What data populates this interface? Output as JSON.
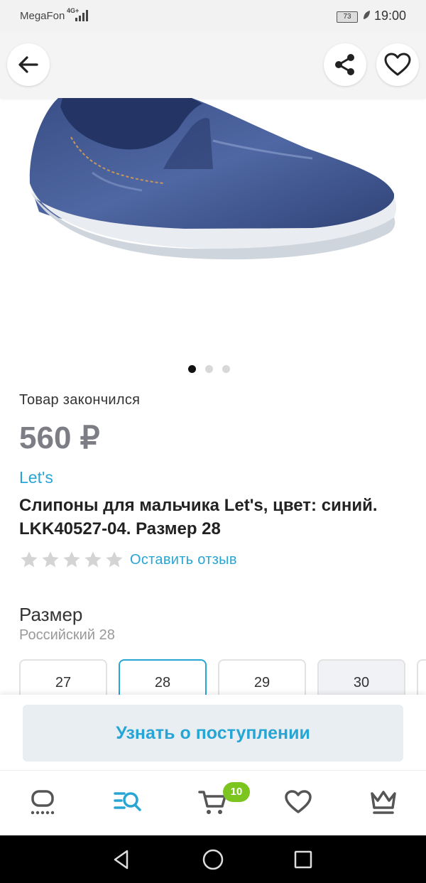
{
  "status_bar": {
    "carrier": "MegaFon",
    "network": "4G+",
    "battery": "73",
    "time": "19:00"
  },
  "top_bar": {
    "back_icon": "arrow-left-icon",
    "share_icon": "share-icon",
    "favorite_icon": "heart-icon"
  },
  "gallery": {
    "image": "blue-denim-slip-on-shoe",
    "pages": 3,
    "current_page": 1
  },
  "product": {
    "stock_status": "Товар закончился",
    "price": "560 ₽",
    "brand": "Let's",
    "title": "Слипоны для мальчика Let's, цвет: синий. LKK40527-04. Размер 28",
    "rating": 0,
    "rating_max": 5,
    "review_link": "Оставить отзыв"
  },
  "size": {
    "heading": "Размер",
    "subtitle": "Российский 28",
    "options": [
      "27",
      "28",
      "29",
      "30"
    ],
    "selected": "28"
  },
  "cta": {
    "label": "Узнать о поступлении"
  },
  "tab_bar": {
    "items": [
      "home-icon",
      "catalog-search-icon",
      "cart-icon",
      "favorites-icon",
      "profile-crown-icon"
    ],
    "active": "catalog-search-icon",
    "cart_count": "10"
  },
  "colors": {
    "accent": "#27a5d4",
    "badge": "#7cc51f",
    "price": "#7d7d85"
  }
}
